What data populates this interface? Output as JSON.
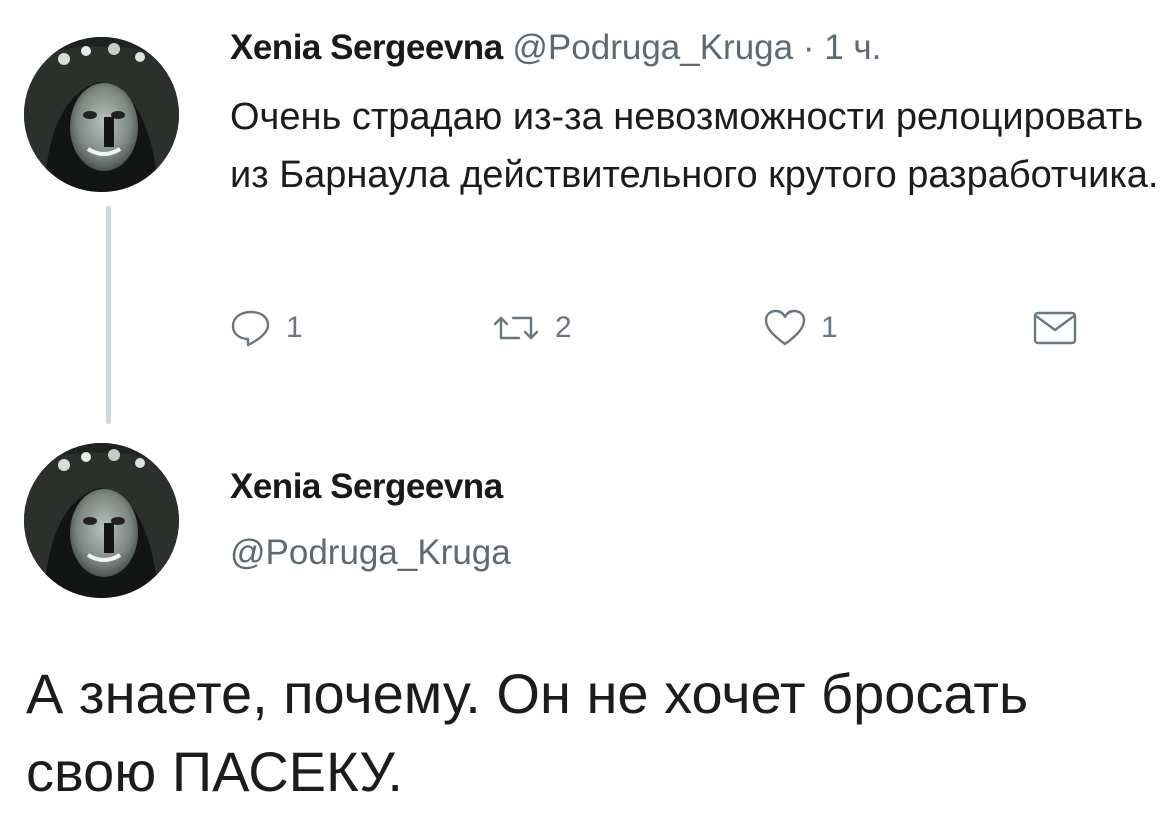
{
  "tweet1": {
    "display_name": "Xenia Sergeevna",
    "handle": "@Podruga_Kruga",
    "separator": "·",
    "timestamp": "1 ч.",
    "text": "Очень страдаю из-за невозможности релоцировать из Барнаула действительного крутого разработчика.",
    "actions": {
      "reply": {
        "icon": "reply-icon",
        "count": "1"
      },
      "retweet": {
        "icon": "retweet-icon",
        "count": "2"
      },
      "like": {
        "icon": "heart-icon",
        "count": "1"
      },
      "dm": {
        "icon": "envelope-icon"
      }
    }
  },
  "tweet2": {
    "display_name": "Xenia Sergeevna",
    "handle": "@Podruga_Kruga",
    "text": "А знаете, почему. Он не хочет бросать свою ПАСЕКУ."
  },
  "colors": {
    "text": "#1c1c1c",
    "secondary": "#5e6a73",
    "thread_line": "#cfd8dd",
    "background": "#ffffff"
  }
}
